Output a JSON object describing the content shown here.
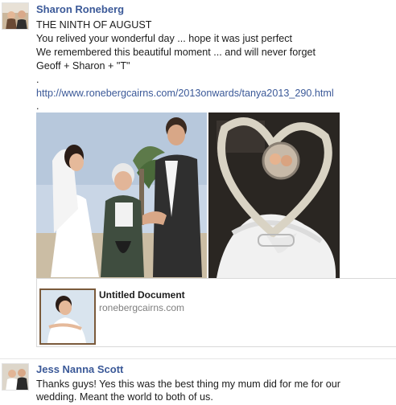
{
  "post": {
    "author": "Sharon Roneberg",
    "lines": [
      "THE  NINTH  OF  AUGUST",
      "You relived your wonderful day ... hope it was just perfect",
      "We remembered this beautiful moment ... and will never forget",
      "Geoff + Sharon + \"T\"",
      "."
    ],
    "link": "http://www.ronebergcairns.com/2013onwards/tanya2013_290.html",
    "trailing": "."
  },
  "link_card": {
    "title": "Untitled Document",
    "domain": "ronebergcairns.com"
  },
  "comment": {
    "author": "Jess Nanna Scott",
    "lines": [
      "Thanks guys! Yes this was the best thing my mum did for me for our",
      "wedding. Meant the world to both of us."
    ]
  },
  "colors": {
    "name_link": "#3b5998",
    "text": "#1c1c1c",
    "muted": "#7f7f7f"
  }
}
